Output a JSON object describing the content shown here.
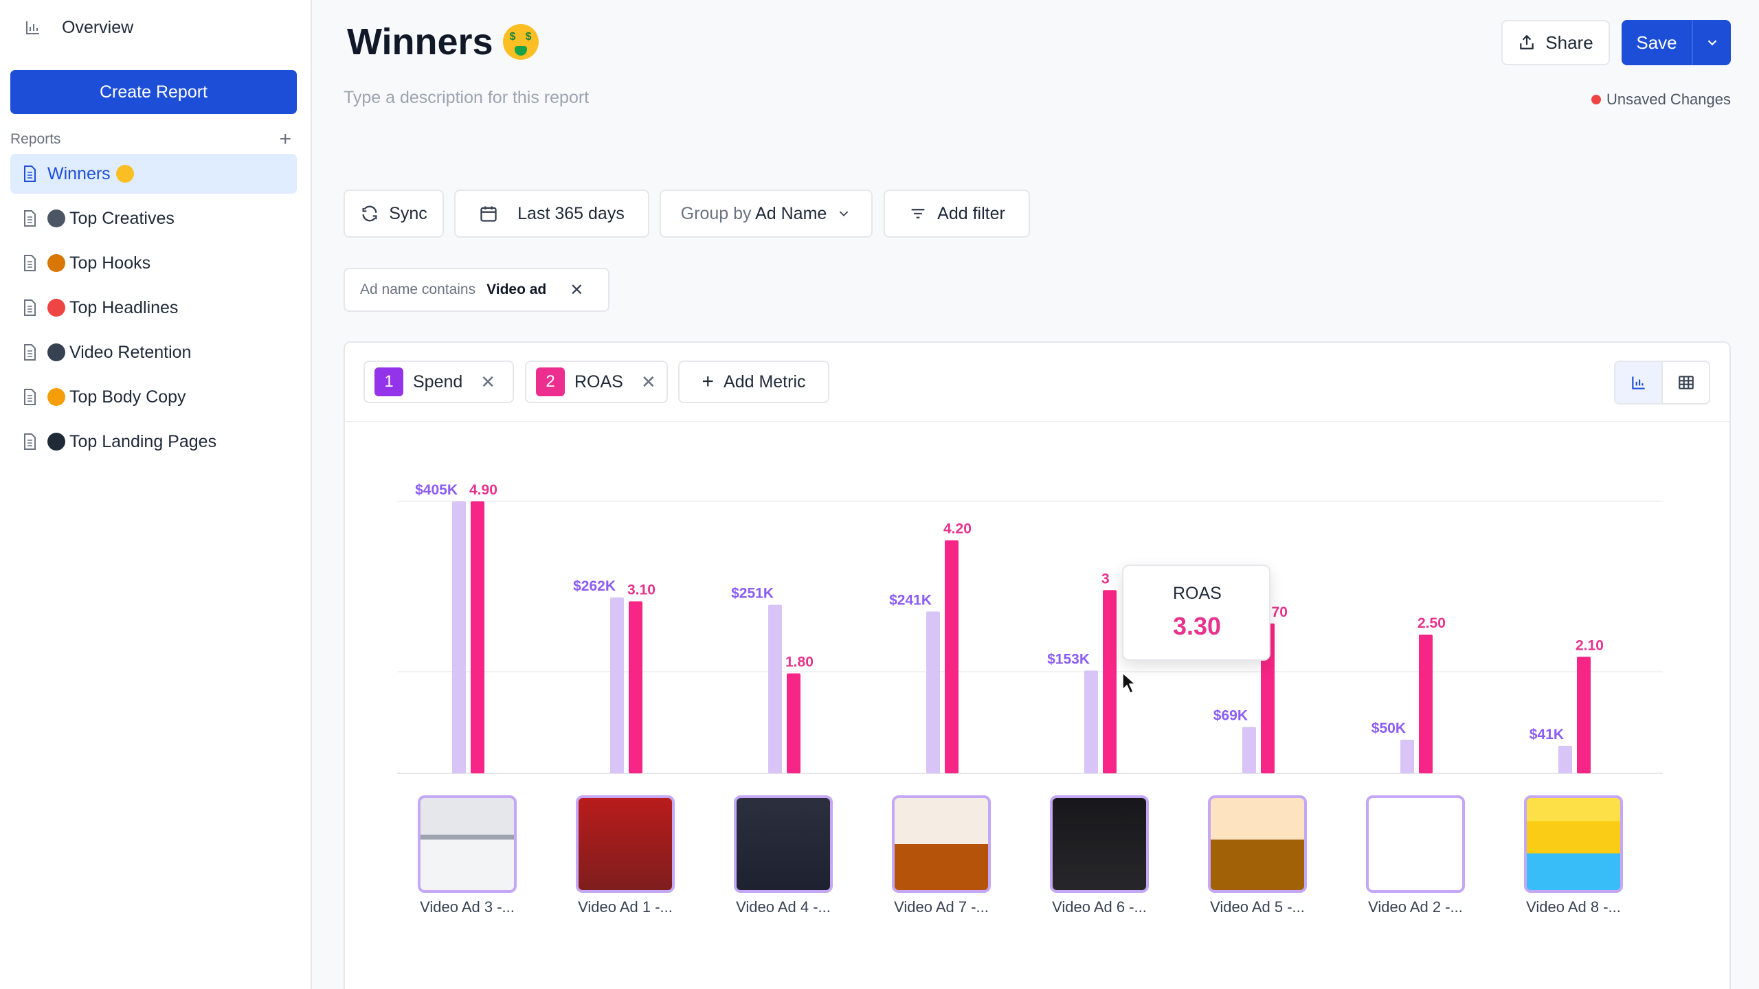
{
  "sidebar": {
    "overview_label": "Overview",
    "create_report_label": "Create Report",
    "reports_heading": "Reports",
    "items": [
      {
        "label": "Winners",
        "icon": "money-mouth-face-emoji",
        "active": true
      },
      {
        "label": "Top Creatives",
        "icon": "student-emoji"
      },
      {
        "label": "Top Hooks",
        "icon": "hook-emoji"
      },
      {
        "label": "Top Headlines",
        "icon": "target-emoji"
      },
      {
        "label": "Video Retention",
        "icon": "video-camera-emoji"
      },
      {
        "label": "Top Body Copy",
        "icon": "memo-emoji"
      },
      {
        "label": "Top Landing Pages",
        "icon": "laptop-emoji"
      }
    ]
  },
  "header": {
    "title": "Winners",
    "description_placeholder": "Type a description for this report",
    "share_label": "Share",
    "save_label": "Save",
    "unsaved_label": "Unsaved Changes"
  },
  "toolbar": {
    "sync_label": "Sync",
    "date_label": "Last 365 days",
    "group_prefix": "Group by",
    "group_value": "Ad Name",
    "add_filter_label": "Add filter"
  },
  "filter_chip": {
    "key": "Ad name contains",
    "value": "Video ad"
  },
  "metrics": [
    {
      "index": "1",
      "label": "Spend",
      "color": "#9333ea"
    },
    {
      "index": "2",
      "label": "ROAS",
      "color": "#ec2f8e"
    }
  ],
  "add_metric_label": "Add Metric",
  "tooltip": {
    "label": "ROAS",
    "value": "3.30"
  },
  "colors": {
    "accent": "#1d4ed8",
    "spend_bar": "#d8c4f7",
    "roas_bar": "#f72585",
    "spend_label": "#8b5cf6",
    "roas_label": "#e8328d"
  },
  "chart_data": {
    "type": "bar",
    "categories": [
      "Video Ad 3 -...",
      "Video Ad 1 -...",
      "Video Ad 4 -...",
      "Video Ad 7 -...",
      "Video Ad 6 -...",
      "Video Ad 5 -...",
      "Video Ad 2 -...",
      "Video Ad 8 -..."
    ],
    "series": [
      {
        "name": "Spend",
        "values": [
          405,
          262,
          251,
          241,
          153,
          69,
          50,
          41
        ],
        "labels": [
          "$405K",
          "$262K",
          "$251K",
          "$241K",
          "$153K",
          "$69K",
          "$50K",
          "$41K"
        ]
      },
      {
        "name": "ROAS",
        "values": [
          4.9,
          3.1,
          1.8,
          4.2,
          3.3,
          2.7,
          2.5,
          2.1
        ],
        "labels": [
          "4.90",
          "3.10",
          "1.80",
          "4.20",
          "3",
          "2.70",
          "2.50",
          "2.10"
        ]
      }
    ],
    "grid": true
  }
}
